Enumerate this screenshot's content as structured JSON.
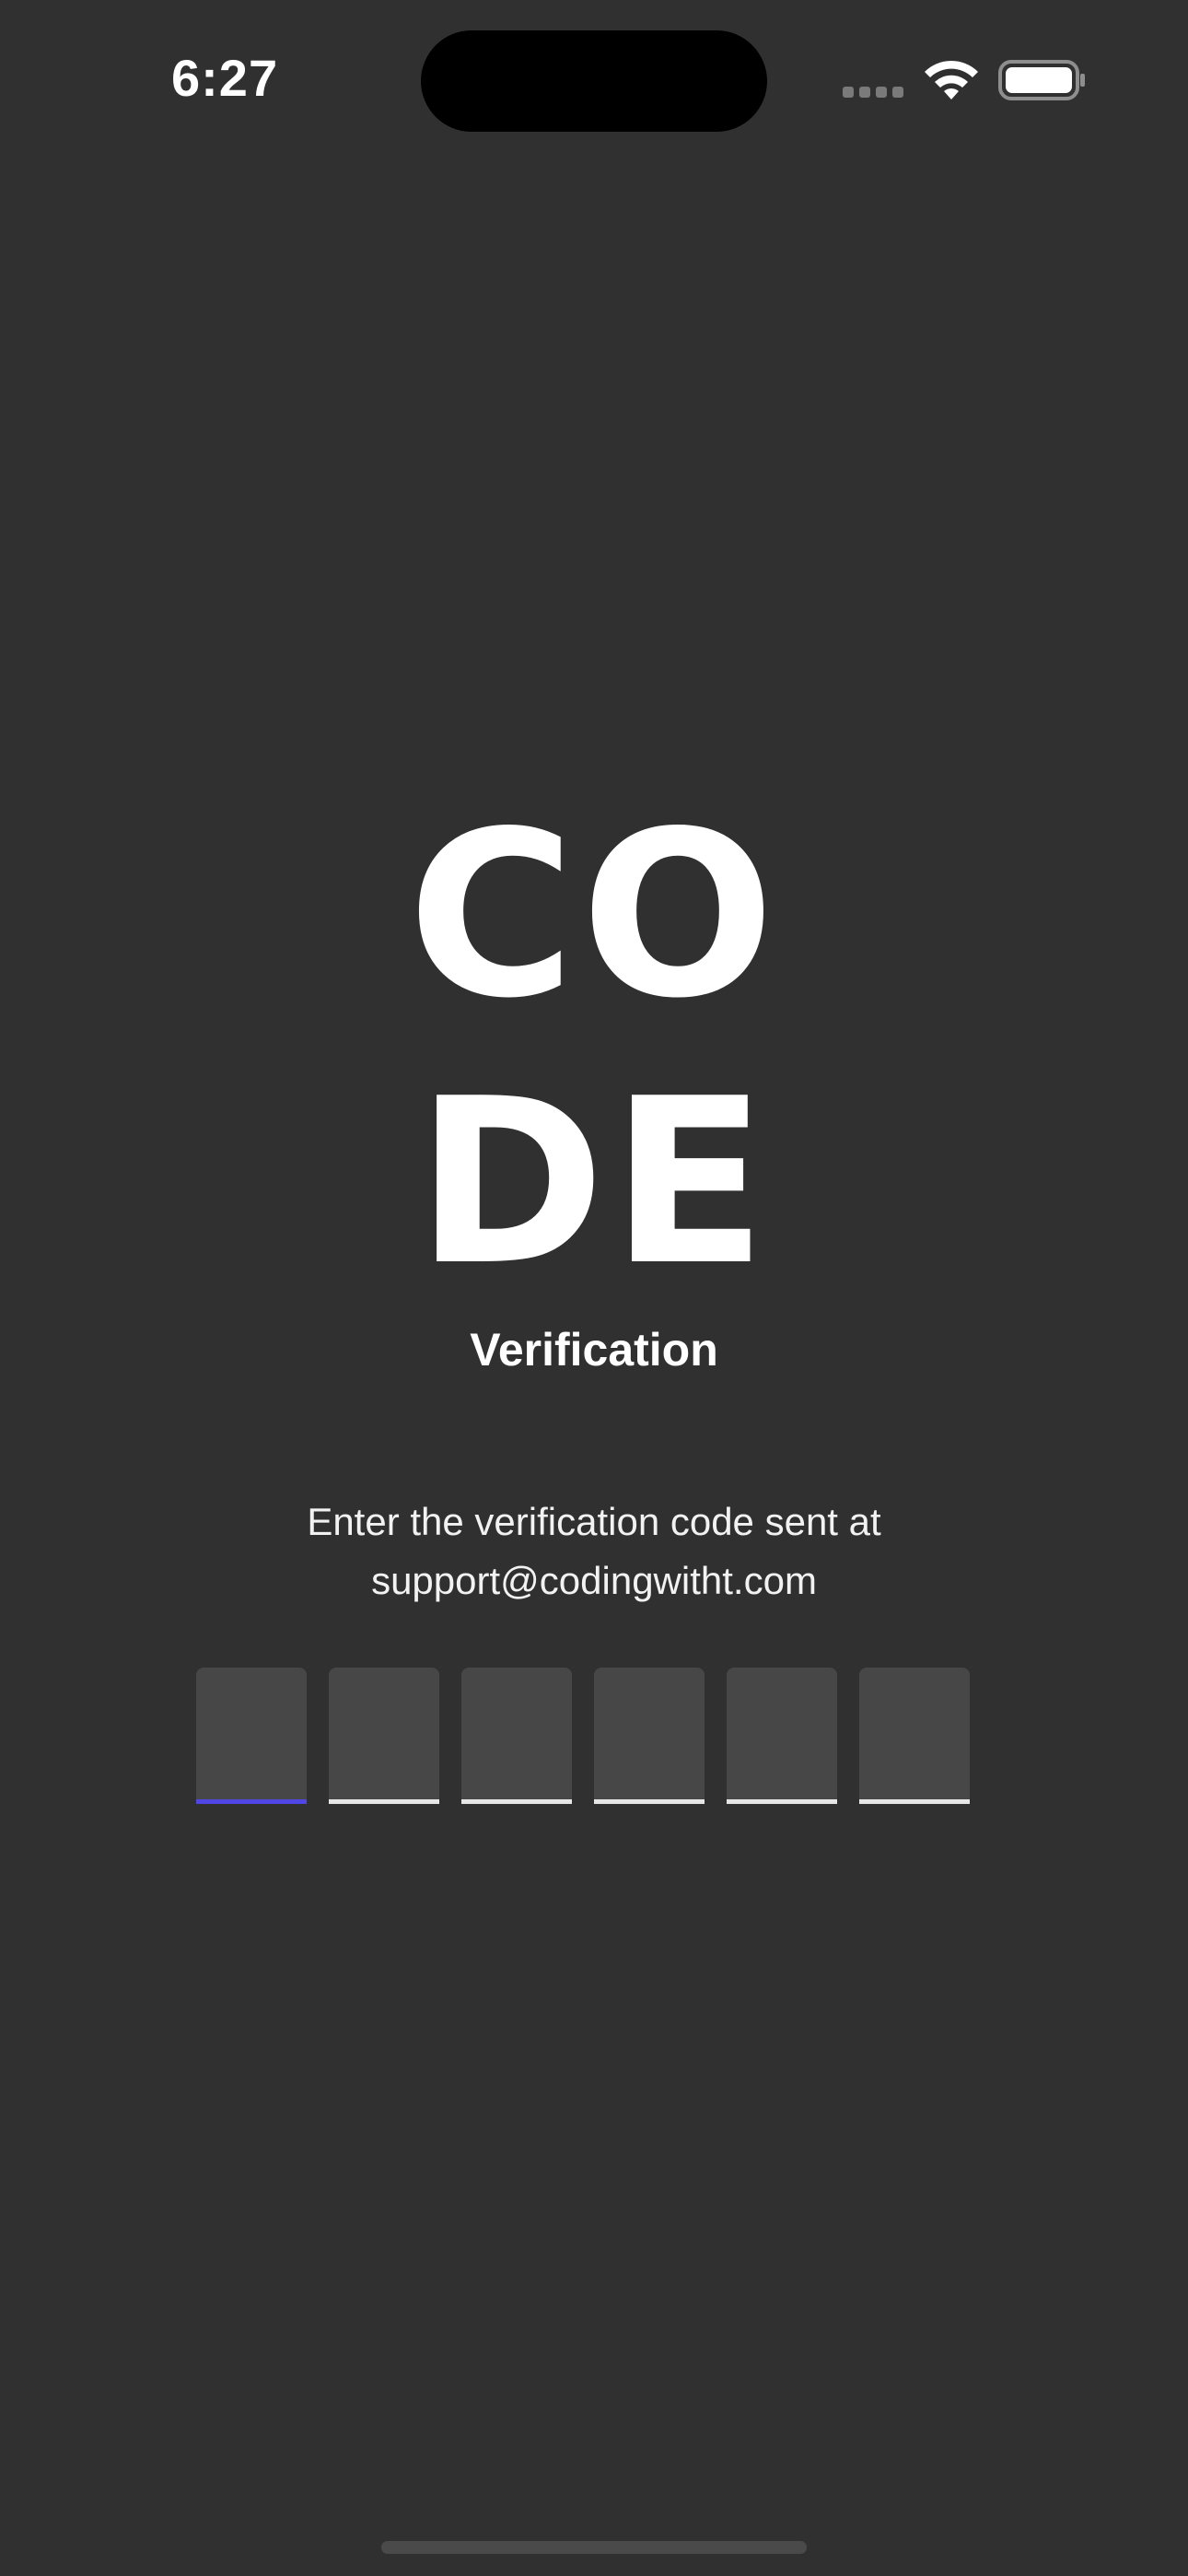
{
  "status_bar": {
    "time": "6:27",
    "icons": [
      "cell-signal-icon",
      "wifi-icon",
      "battery-icon"
    ]
  },
  "logo": {
    "line1": "CO",
    "line2": "DE"
  },
  "subtitle": "Verification",
  "instructions": {
    "line1": "Enter the verification code sent at",
    "line2": "support@codingwitht.com"
  },
  "otp": {
    "length": 6,
    "active_index": 0,
    "colors": {
      "active_underline": "#4f46e5",
      "inactive_underline": "#e6e6e6",
      "box_fill": "#474747"
    }
  },
  "theme": {
    "background": "#303030",
    "text": "#ffffff"
  }
}
